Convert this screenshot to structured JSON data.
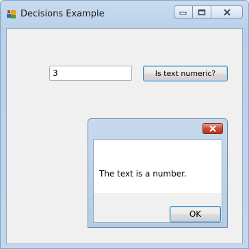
{
  "window": {
    "title": "Decisions Example",
    "buttons": {
      "minimize": "minimize-icon",
      "maximize": "maximize-icon",
      "close": "close-icon"
    }
  },
  "form": {
    "textbox_value": "3",
    "check_button_label": "Is text numeric?"
  },
  "message_box": {
    "message": "The text is a number.",
    "ok_label": "OK"
  }
}
